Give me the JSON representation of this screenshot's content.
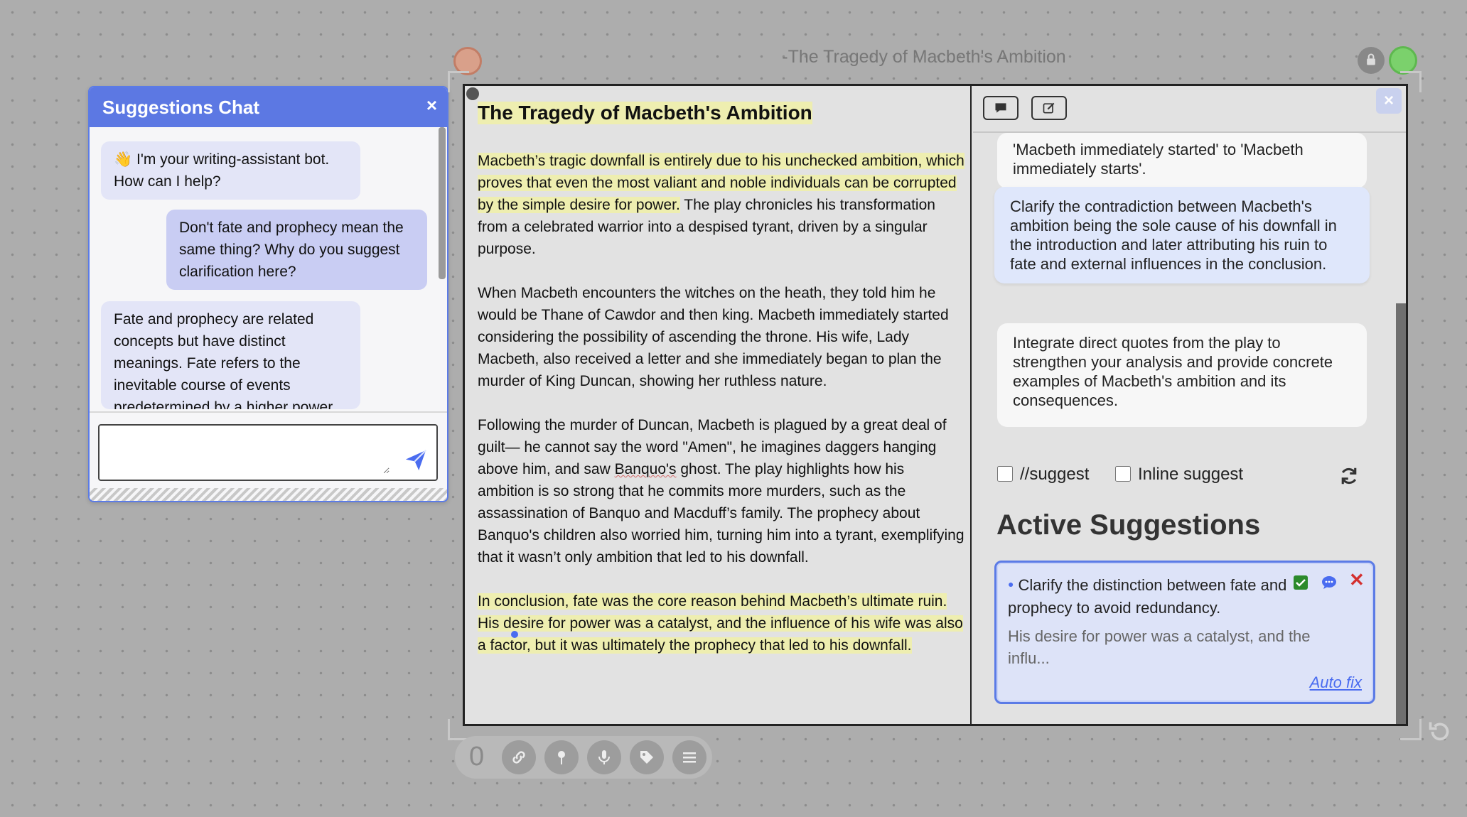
{
  "chat": {
    "title": "Suggestions Chat",
    "close_label": "×",
    "messages": [
      {
        "role": "bot",
        "text": "👋 I'm your writing-assistant bot. How can I help?"
      },
      {
        "role": "user",
        "text": "Don't fate and prophecy mean the same thing? Why do you suggest clarification here?"
      },
      {
        "role": "bot",
        "text": "Fate and prophecy are related concepts but have distinct meanings. Fate refers to the inevitable course of events predetermined by a higher power"
      }
    ],
    "input_value": "",
    "input_placeholder": ""
  },
  "window": {
    "title": "-The Tragedy of Macbeth's Ambition",
    "close_label": "×"
  },
  "essay": {
    "title": "The Tragedy of Macbeth's Ambition",
    "p1_hl": "Macbeth’s tragic downfall is entirely due to his unchecked ambition, which proves that even the most valiant and noble individuals can be corrupted by the simple desire for power.",
    "p1_rest": " The play chronicles his transformation from a celebrated warrior into a despised tyrant, driven by a singular purpose.",
    "p2": "When Macbeth encounters the witches on the heath, they told him he would be Thane of Cawdor and then king. Macbeth immediately started considering the possibility of ascending the throne. His wife, Lady Macbeth, also received a letter and she immediately began to plan the murder of King Duncan, showing her ruthless nature.",
    "p3_a": "Following the murder of Duncan, Macbeth is plagued by a great deal of guilt— he cannot say the word \"Amen\", he imagines daggers hanging above him, and saw ",
    "p3_squiggle": "Banquo's",
    "p3_b": " ghost. The play highlights how his ambition is so strong that he commits more murders, such as the assassination of Banquo and Macduff’s family. The prophecy about Banquo's children also worried him, turning him into a tyrant, exemplifying that it wasn’t only ambition that led to his downfall.",
    "p4_hl": "In conclusion, fate was the core reason behind Macbeth’s ultimate ruin. His desire for power was a catalyst, and the influence of his wife was also a factor, but it was ultimately the prophecy that led to his downfall."
  },
  "suggestions": {
    "cards": [
      "'Macbeth immediately started' to 'Macbeth immediately starts'.",
      "Clarify the contradiction between Macbeth's ambition being the sole cause of his downfall in the introduction and later attributing his ruin to fate and external influences in the conclusion.",
      "Integrate direct quotes from the play to strengthen your analysis and provide concrete examples of Macbeth's ambition and its consequences."
    ],
    "checkbox_suggest": "//suggest",
    "checkbox_inline": "Inline suggest",
    "active_heading": "Active Suggestions",
    "active": {
      "text": "Clarify the distinction between fate and prophecy to avoid redundancy.",
      "excerpt": "His desire for power was a catalyst, and the influ...",
      "auto_fix": "Auto fix"
    }
  },
  "toolbar": {
    "count": "0",
    "tools": [
      "link-icon",
      "pin-icon",
      "mic-icon",
      "tag-icon",
      "menu-icon"
    ]
  },
  "colors": {
    "accent": "#5c78e3",
    "highlight": "#eeeeb0",
    "reject": "#d43030",
    "accept": "#2b8a2b"
  }
}
